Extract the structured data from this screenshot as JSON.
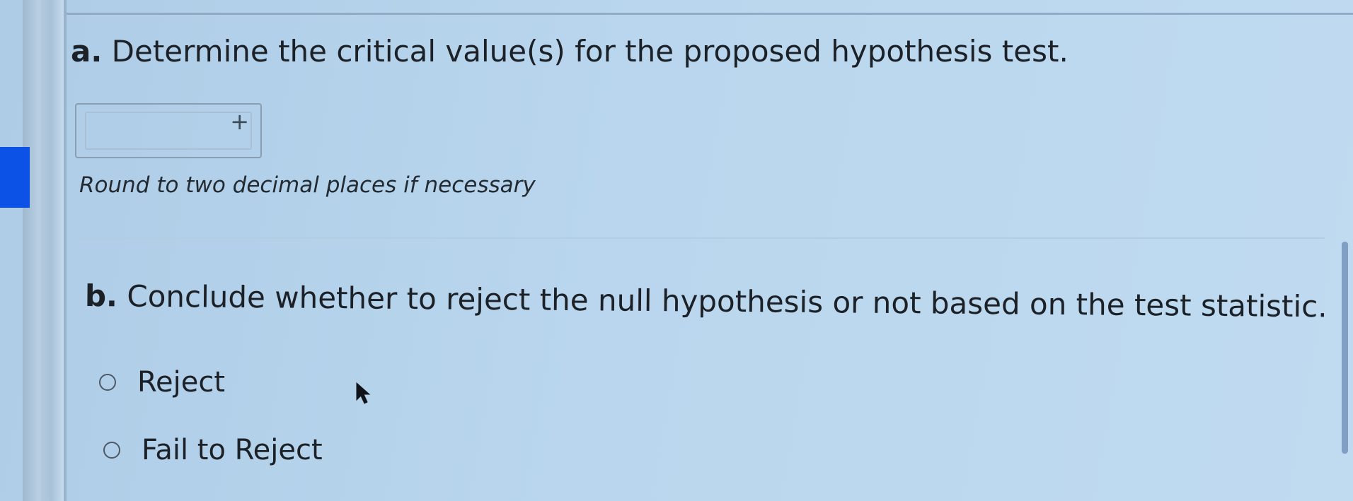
{
  "part_a": {
    "letter": "a.",
    "question": "Determine the critical value(s) for the proposed hypothesis test.",
    "answer_value": "",
    "add_icon": "plus-icon",
    "hint": "Round to two decimal places if necessary"
  },
  "part_b": {
    "letter": "b.",
    "question": "Conclude whether to reject the null hypothesis or not based on the test statistic.",
    "options": [
      {
        "label": "Reject",
        "selected": false
      },
      {
        "label": "Fail to Reject",
        "selected": false
      }
    ]
  },
  "colors": {
    "background": "#b9d6ee",
    "accent_tab": "#0d52e6",
    "text": "#1c2127"
  }
}
